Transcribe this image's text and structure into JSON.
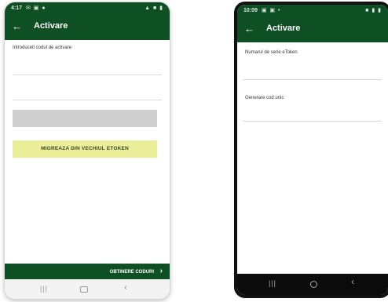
{
  "left_screen": {
    "status": {
      "time": "4:17",
      "sys_icons": "✉ ▣ ●",
      "right_icons": "▲ ■ ▮"
    },
    "appbar": {
      "back_glyph": "←",
      "title": "Activare"
    },
    "activation_code": {
      "label": "Introduceti codul de activare",
      "value": ""
    },
    "disabled_button": {
      "label": ""
    },
    "migrate_button": {
      "label": "MIGREAZA DIN VECHIUL ETOKEN"
    },
    "footer": {
      "codes_label": "OBTINERE CODURI",
      "chevron": "›"
    },
    "navbar": {
      "recents": "|||",
      "back": "‹"
    }
  },
  "right_screen": {
    "status": {
      "time": "10:09",
      "sys_icons": "▣ ▣ •",
      "right_icons": "■ ▮ ▮"
    },
    "appbar": {
      "back_glyph": "←",
      "title": "Activare"
    },
    "serial_number": {
      "label": "Numarul de serie eToken",
      "value": ""
    },
    "unique_code": {
      "label": "Generare cod unic",
      "value": ""
    },
    "navbar": {
      "recents": "|||",
      "back": "‹"
    }
  },
  "colors": {
    "primary_green": "#0e4f23",
    "migrate_button_bg": "#ebee98",
    "disabled_button_bg": "#cfcfcf"
  }
}
